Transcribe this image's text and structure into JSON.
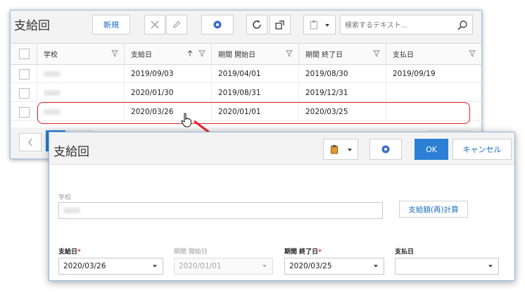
{
  "list_window": {
    "title": "支給回",
    "new_button": "新規",
    "search": {
      "placeholder": "検索するテキスト..."
    },
    "columns": [
      "学校",
      "支給日",
      "期間 開始日",
      "期間 終了日",
      "支払日"
    ],
    "rows": [
      {
        "school": "",
        "pay_date": "2019/09/03",
        "start": "2019/04/01",
        "end": "2019/08/30",
        "paid": "2019/09/19"
      },
      {
        "school": "",
        "pay_date": "2020/01/30",
        "start": "2019/08/31",
        "end": "2019/12/31",
        "paid": ""
      },
      {
        "school": "",
        "pay_date": "2020/03/26",
        "start": "2020/01/01",
        "end": "2020/03/25",
        "paid": ""
      }
    ],
    "highlight_color": "#e8222a",
    "accent": "#2b7fd4"
  },
  "dialog": {
    "title": "支給回",
    "ok_button": "OK",
    "cancel_button": "キャンセル",
    "school_label": "学校",
    "recalc_button": "支給額(再)計算",
    "fields": {
      "pay_date": {
        "label": "支給日",
        "required_mark": "*",
        "value": "2020/03/26"
      },
      "period_start": {
        "label": "期間 開始日",
        "value": "2020/01/01"
      },
      "period_end": {
        "label": "期間 終了日",
        "required_mark": "*",
        "value": "2020/03/25"
      },
      "paid_date": {
        "label": "支払日",
        "value": ""
      }
    }
  }
}
